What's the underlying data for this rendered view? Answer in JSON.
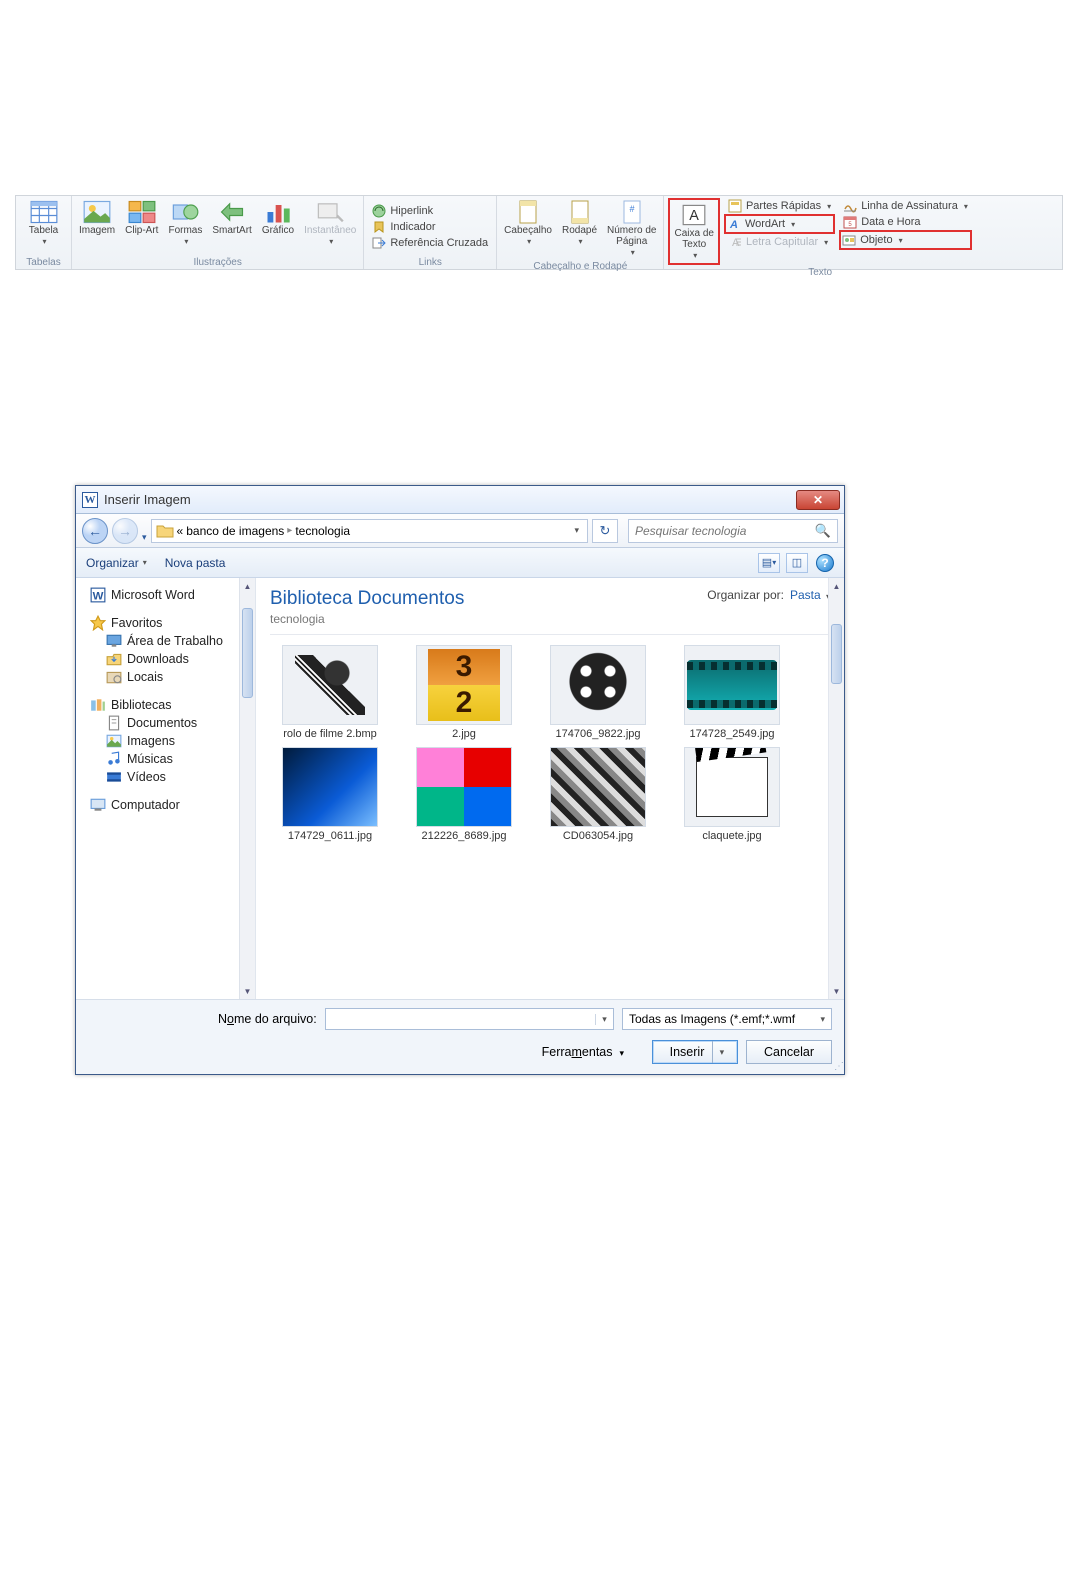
{
  "ribbon": {
    "groups": {
      "tabelas": {
        "label": "Tabelas",
        "tabela": "Tabela"
      },
      "ilustracoes": {
        "label": "Ilustrações",
        "imagem": "Imagem",
        "clipart": "Clip-Art",
        "formas": "Formas",
        "smartart": "SmartArt",
        "grafico": "Gráfico",
        "instantaneo": "Instantâneo"
      },
      "links": {
        "label": "Links",
        "hiperlink": "Hiperlink",
        "indicador": "Indicador",
        "ref": "Referência Cruzada"
      },
      "cabecalho": {
        "label": "Cabeçalho e Rodapé",
        "cabecalho": "Cabeçalho",
        "rodape": "Rodapé",
        "numero": "Número de\nPágina"
      },
      "texto": {
        "label": "Texto",
        "caixa": "Caixa de\nTexto",
        "partes": "Partes Rápidas",
        "wordart": "WordArt",
        "letra": "Letra Capitular",
        "assinatura": "Linha de Assinatura",
        "data": "Data e Hora",
        "objeto": "Objeto"
      }
    }
  },
  "dialog": {
    "title": "Inserir Imagem",
    "breadcrumb": {
      "prefix": "«",
      "p1": "banco de imagens",
      "p2": "tecnologia"
    },
    "search_placeholder": "Pesquisar tecnologia",
    "toolbar": {
      "organizar": "Organizar",
      "nova": "Nova pasta"
    },
    "tree": {
      "word": "Microsoft Word",
      "fav": "Favoritos",
      "fav_items": [
        "Área de Trabalho",
        "Downloads",
        "Locais"
      ],
      "bib": "Bibliotecas",
      "bib_items": [
        "Documentos",
        "Imagens",
        "Músicas",
        "Vídeos"
      ],
      "comp": "Computador"
    },
    "content": {
      "lib_title": "Biblioteca Documentos",
      "lib_sub": "tecnologia",
      "arrange_label": "Organizar por:",
      "arrange_value": "Pasta",
      "files": [
        "rolo de filme 2.bmp",
        "2.jpg",
        "174706_9822.jpg",
        "174728_2549.jpg",
        "174729_0611.jpg",
        "212226_8689.jpg",
        "CD063054.jpg",
        "claquete.jpg"
      ]
    },
    "footer": {
      "filename_label_pre": "N",
      "filename_label_u": "o",
      "filename_label_post": "me do arquivo:",
      "filter": "Todas as Imagens (*.emf;*.wmf",
      "tools_pre": "Ferra",
      "tools_u": "m",
      "tools_post": "entas",
      "insert": "Inserir",
      "cancel": "Cancelar"
    }
  }
}
